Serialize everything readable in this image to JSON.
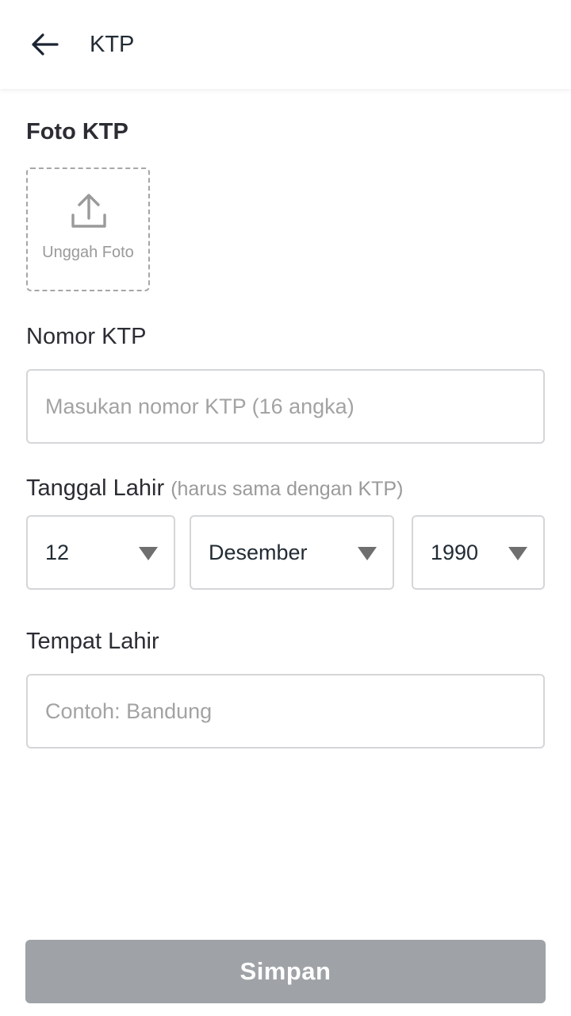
{
  "header": {
    "title": "KTP",
    "back_icon": "arrow-left-icon"
  },
  "photo": {
    "label": "Foto KTP",
    "upload_label": "Unggah Foto",
    "upload_icon": "upload-icon"
  },
  "nik": {
    "label": "Nomor KTP",
    "placeholder": "Masukan nomor KTP (16 angka)",
    "value": ""
  },
  "birth_date": {
    "label": "Tanggal Lahir",
    "hint": "(harus sama dengan KTP)",
    "day": "12",
    "month": "Desember",
    "year": "1990"
  },
  "birth_place": {
    "label": "Tempat Lahir",
    "placeholder": "Contoh: Bandung",
    "value": ""
  },
  "actions": {
    "save_label": "Simpan"
  },
  "colors": {
    "text": "#222c35",
    "placeholder": "#a3a3a3",
    "border": "#d5d6d8",
    "button_disabled": "#9fa2a6"
  }
}
